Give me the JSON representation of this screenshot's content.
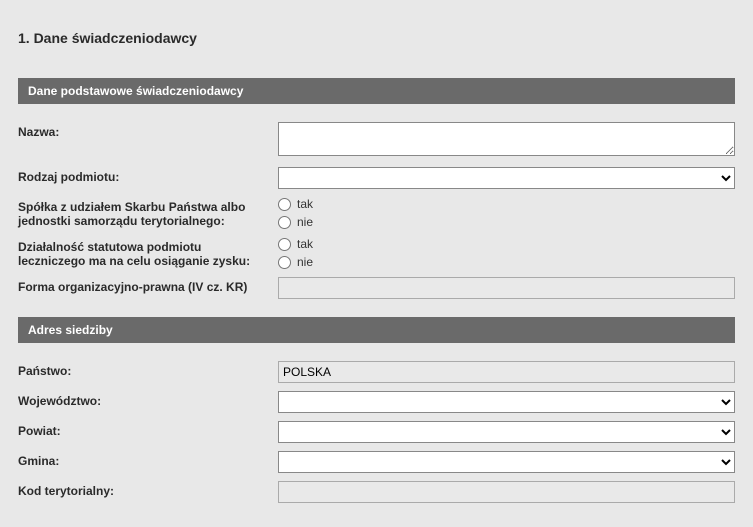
{
  "page": {
    "title": "1. Dane świadczeniodawcy"
  },
  "sections": {
    "basic": {
      "header": "Dane podstawowe świadczeniodawcy"
    },
    "address": {
      "header": "Adres siedziby"
    }
  },
  "fields": {
    "nazwa": {
      "label": "Nazwa:",
      "value": ""
    },
    "rodzaj_podmiotu": {
      "label": "Rodzaj podmiotu:",
      "value": ""
    },
    "spolka_skarbu": {
      "label": "Spółka z udziałem Skarbu Państwa albo jednostki samorządu terytorialnego:",
      "options": {
        "tak": "tak",
        "nie": "nie"
      }
    },
    "dzialalnosc_statutowa": {
      "label": "Działalność statutowa podmiotu leczniczego ma na celu osiąganie zysku:",
      "options": {
        "tak": "tak",
        "nie": "nie"
      }
    },
    "forma_org": {
      "label": "Forma organizacyjno-prawna (IV cz. KR)",
      "value": ""
    },
    "panstwo": {
      "label": "Państwo:",
      "value": "POLSKA"
    },
    "wojewodztwo": {
      "label": "Województwo:",
      "value": ""
    },
    "powiat": {
      "label": "Powiat:",
      "value": ""
    },
    "gmina": {
      "label": "Gmina:",
      "value": ""
    },
    "kod_teryt": {
      "label": "Kod terytorialny:",
      "value": ""
    }
  }
}
